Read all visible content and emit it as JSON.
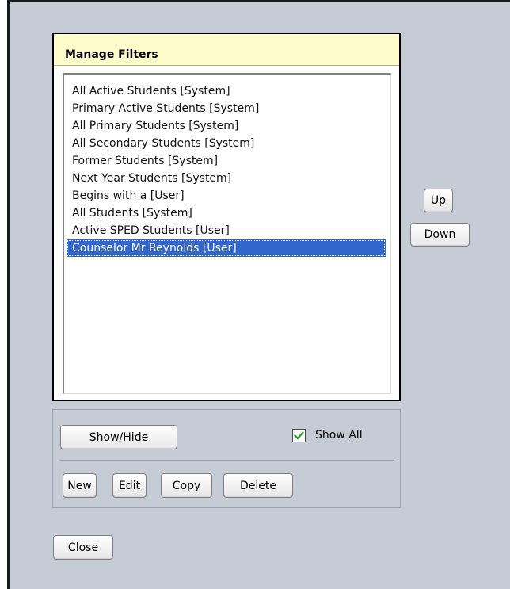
{
  "panel": {
    "title": "Manage Filters",
    "items": [
      "All Active Students [System]",
      "Primary Active Students [System]",
      "All Primary Students [System]",
      "All Secondary Students [System]",
      "Former Students [System]",
      "Next Year Students [System]",
      "Begins with a [User]",
      "All Students [System]",
      "Active SPED Students [User]",
      "Counselor Mr Reynolds [User]"
    ],
    "selected_index": 9
  },
  "reorder": {
    "up_label": "Up",
    "down_label": "Down"
  },
  "actions": {
    "show_hide_label": "Show/Hide",
    "show_all_label": "Show All",
    "show_all_checked": true,
    "new_label": "New",
    "edit_label": "Edit",
    "copy_label": "Copy",
    "delete_label": "Delete"
  },
  "footer": {
    "close_label": "Close"
  },
  "colors": {
    "background": "#c5ccd6",
    "header": "#fdfbc9",
    "selection": "#3366cc",
    "check": "#2e9e2e"
  }
}
